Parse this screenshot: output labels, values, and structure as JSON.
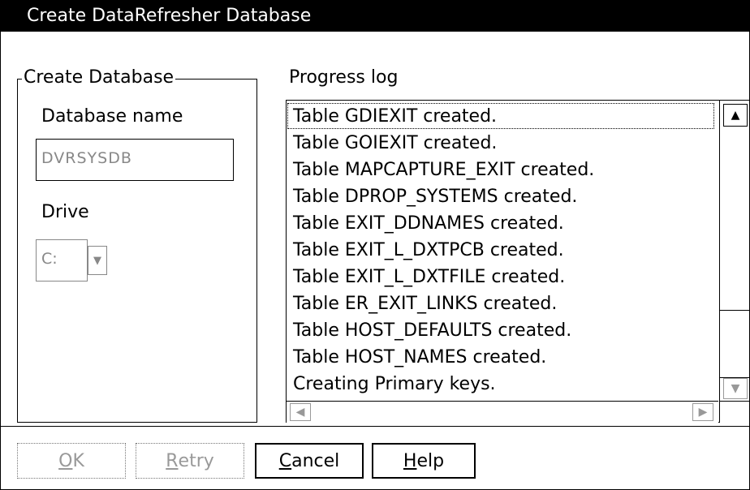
{
  "window": {
    "title": "Create DataRefresher Database"
  },
  "create_group": {
    "legend": "Create Database",
    "database_name_label": "Database name",
    "database_name_value": "DVRSYSDB",
    "drive_label": "Drive",
    "drive_value": "C:",
    "drive_dropdown_icon": "chevron-down-icon"
  },
  "progress": {
    "label": "Progress log",
    "items": [
      "Table GDIEXIT created.",
      "Table GOIEXIT created.",
      "Table MAPCAPTURE_EXIT created.",
      "Table DPROP_SYSTEMS created.",
      "Table EXIT_DDNAMES created.",
      "Table EXIT_L_DXTPCB created.",
      "Table EXIT_L_DXTFILE created.",
      "Table ER_EXIT_LINKS created.",
      "Table HOST_DEFAULTS created.",
      "Table HOST_NAMES created.",
      "Creating Primary keys."
    ],
    "vertical_scroll_position": 0.82
  },
  "buttons": {
    "ok": {
      "mnemonic": "O",
      "rest": "K",
      "enabled": false
    },
    "retry": {
      "mnemonic": "R",
      "rest": "etry",
      "enabled": false
    },
    "cancel": {
      "mnemonic": "C",
      "rest": "ancel",
      "enabled": true
    },
    "help": {
      "mnemonic": "H",
      "rest": "elp",
      "enabled": true
    }
  }
}
